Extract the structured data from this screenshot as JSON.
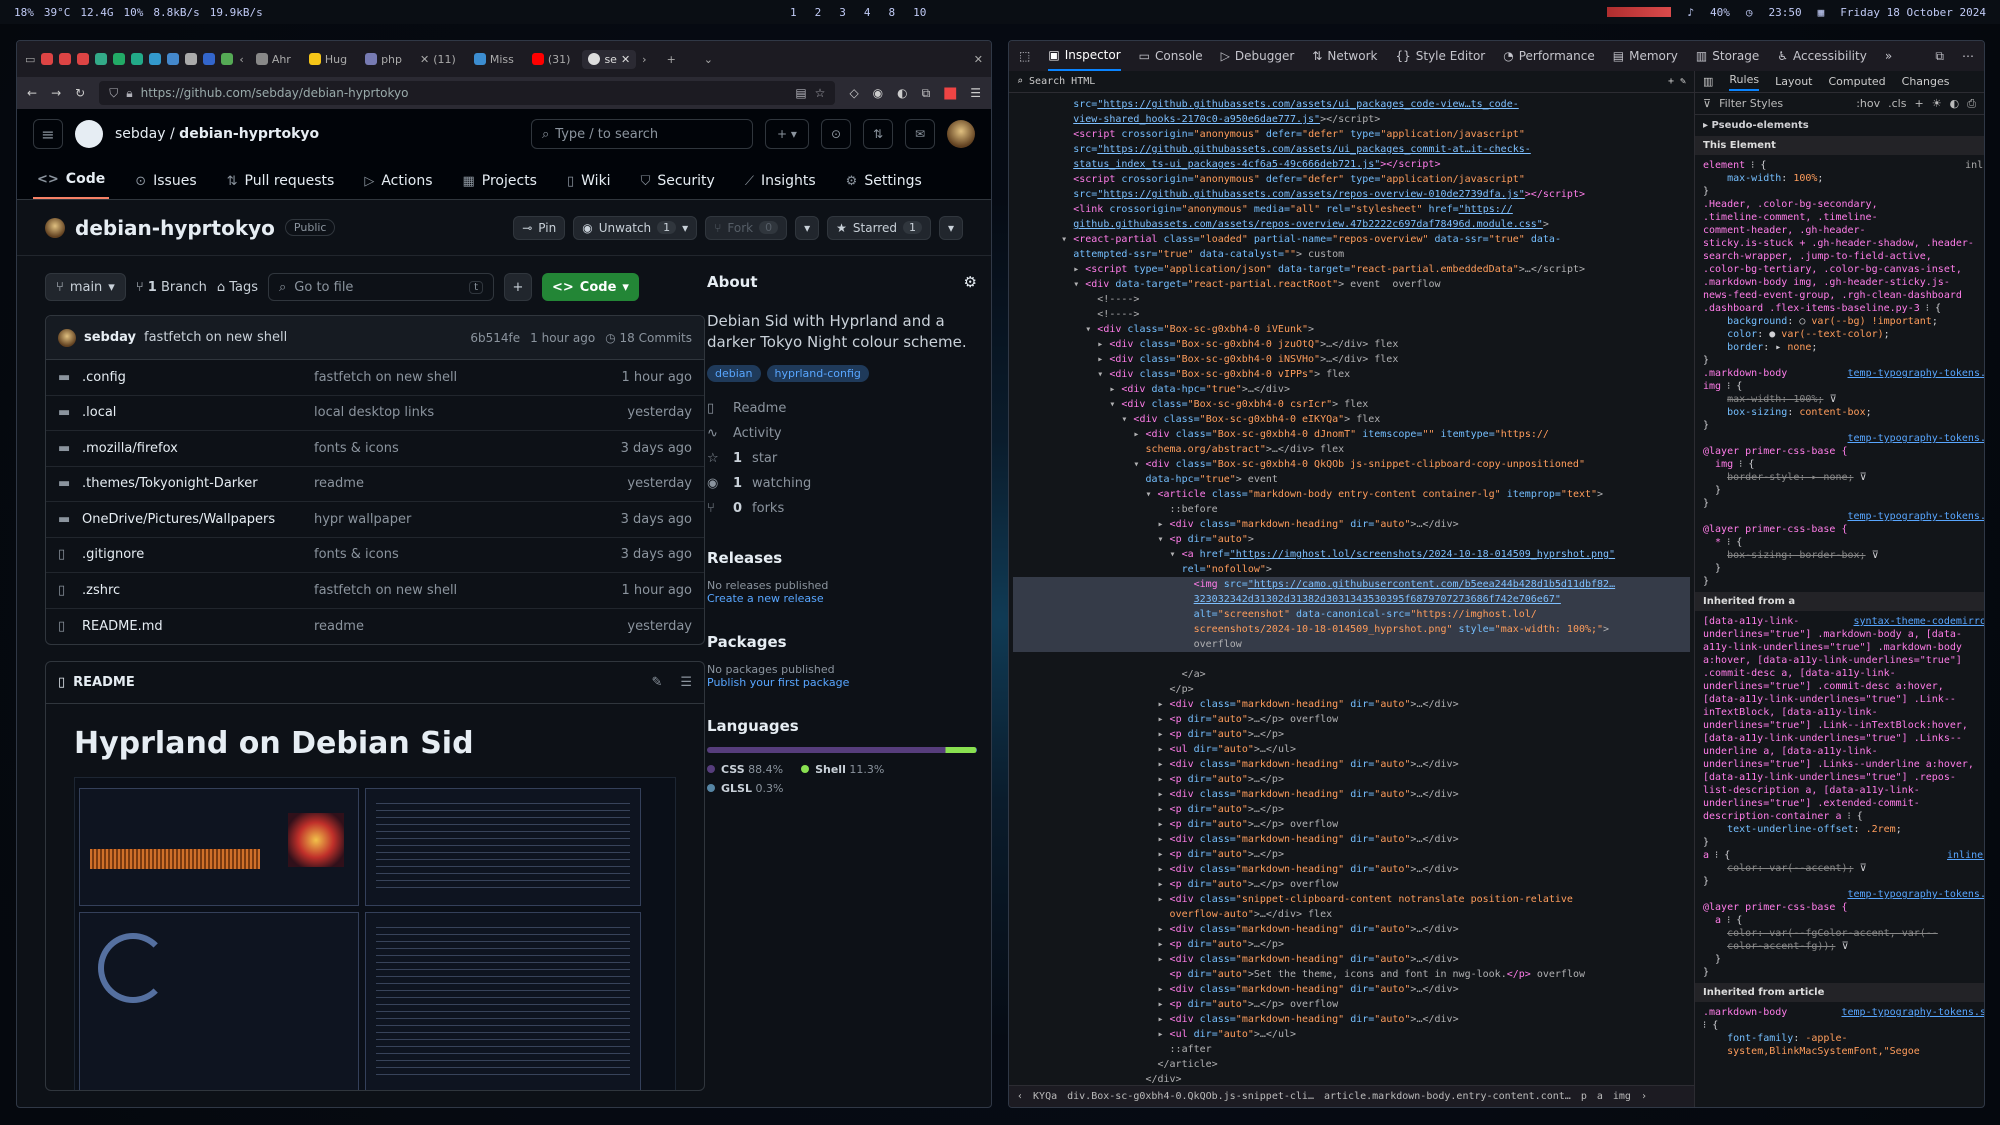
{
  "system_bar": {
    "cpu": "18%",
    "temp": "39°C",
    "mem": "12.4G",
    "swap": "10%",
    "net_down": "8.8kB/s",
    "net_up": "19.9kB/s",
    "workspaces": [
      "1",
      "2",
      "3",
      "4",
      "8",
      "10"
    ],
    "volume": "40%",
    "time": "23:50",
    "date": "Friday 18 October 2024"
  },
  "browser": {
    "tabs": [
      {
        "label": "Ahr",
        "icon": "tab-favicon",
        "color": "#888888"
      },
      {
        "label": "Hug",
        "icon": "huggingface-favicon",
        "color": "#f5c518"
      },
      {
        "label": "php",
        "icon": "php-favicon",
        "color": "#777bb3"
      },
      {
        "label": "(11)",
        "icon": "x-favicon",
        "color": "#dddddd"
      },
      {
        "label": "Miss",
        "icon": "mastodon-favicon",
        "color": "#3c8dd0"
      },
      {
        "label": "(31)",
        "icon": "youtube-favicon",
        "color": "#ff0000"
      },
      {
        "label": "se",
        "icon": "github-favicon",
        "color": "#dddddd",
        "active": true
      }
    ],
    "url": "https://github.com/sebday/debian-hyprtokyo"
  },
  "github": {
    "owner": "sebday",
    "repo": "debian-hyprtokyo",
    "search_placeholder": "Type / to search",
    "nav": [
      "Code",
      "Issues",
      "Pull requests",
      "Actions",
      "Projects",
      "Wiki",
      "Security",
      "Insights",
      "Settings"
    ],
    "repo_name": "debian-hyprtokyo",
    "visibility": "Public",
    "pin": "Pin",
    "unwatch": "Unwatch",
    "watch_count": "1",
    "fork": "Fork",
    "fork_count": "0",
    "starred": "Starred",
    "star_count": "1",
    "branch": "main",
    "branch_count": "1",
    "branch_label": "Branch",
    "tags": "Tags",
    "goto_file": "Go to file",
    "kbd": "t",
    "code_button": "Code",
    "commit": {
      "user": "sebday",
      "message": "fastfetch on new shell",
      "hash": "6b514fe",
      "time": "1 hour ago",
      "commits": "18 Commits"
    },
    "files": [
      {
        "type": "dir",
        "name": ".config",
        "msg": "fastfetch on new shell",
        "date": "1 hour ago"
      },
      {
        "type": "dir",
        "name": ".local",
        "msg": "local desktop links",
        "date": "yesterday"
      },
      {
        "type": "dir",
        "name": ".mozilla/firefox",
        "msg": "fonts & icons",
        "date": "3 days ago"
      },
      {
        "type": "dir",
        "name": ".themes/Tokyonight-Darker",
        "msg": "readme",
        "date": "yesterday"
      },
      {
        "type": "dir",
        "name": "OneDrive/Pictures/Wallpapers",
        "msg": "hypr wallpaper",
        "date": "3 days ago"
      },
      {
        "type": "file",
        "name": ".gitignore",
        "msg": "fonts & icons",
        "date": "3 days ago"
      },
      {
        "type": "file",
        "name": ".zshrc",
        "msg": "fastfetch on new shell",
        "date": "1 hour ago"
      },
      {
        "type": "file",
        "name": "README.md",
        "msg": "readme",
        "date": "yesterday"
      }
    ],
    "readme_label": "README",
    "readme_title": "Hyprland on Debian Sid",
    "about": {
      "title": "About",
      "description": "Debian Sid with Hyprland and a darker Tokyo Night colour scheme.",
      "topics": [
        "debian",
        "hyprland-config"
      ],
      "readme": "Readme",
      "activity": "Activity",
      "stars": "1",
      "stars_label": "star",
      "watching": "1",
      "watching_label": "watching",
      "forks": "0",
      "forks_label": "forks"
    },
    "releases": {
      "title": "Releases",
      "text": "No releases published",
      "link": "Create a new release"
    },
    "packages": {
      "title": "Packages",
      "text": "No packages published",
      "link": "Publish your first package"
    },
    "languages": {
      "title": "Languages",
      "items": [
        {
          "name": "CSS",
          "pct": "88.4%",
          "value": 88.4,
          "color": "#563d7c"
        },
        {
          "name": "Shell",
          "pct": "11.3%",
          "value": 11.3,
          "color": "#89e051"
        },
        {
          "name": "GLSL",
          "pct": "0.3%",
          "value": 0.3,
          "color": "#5686a5"
        }
      ]
    }
  },
  "devtools": {
    "tabs": [
      "Inspector",
      "Console",
      "Debugger",
      "Network",
      "Style Editor",
      "Performance",
      "Memory",
      "Storage",
      "Accessibility"
    ],
    "search_placeholder": "Search HTML",
    "rule_tabs": [
      "Rules",
      "Layout",
      "Computed",
      "Changes"
    ],
    "filter_placeholder": "Filter Styles",
    "hov": ":hov",
    "cls": ".cls",
    "pseudo": "Pseudo-elements",
    "this_element": "This Element",
    "inherited_a": "Inherited from a",
    "inherited_article": "Inherited from article",
    "breadcrumbs": [
      "KYQa",
      "div.Box-sc-g0xbh4-0.QkQOb.js-snippet-cli…",
      "article.markdown-body.entry-content.cont…",
      "p",
      "a",
      "img"
    ]
  }
}
